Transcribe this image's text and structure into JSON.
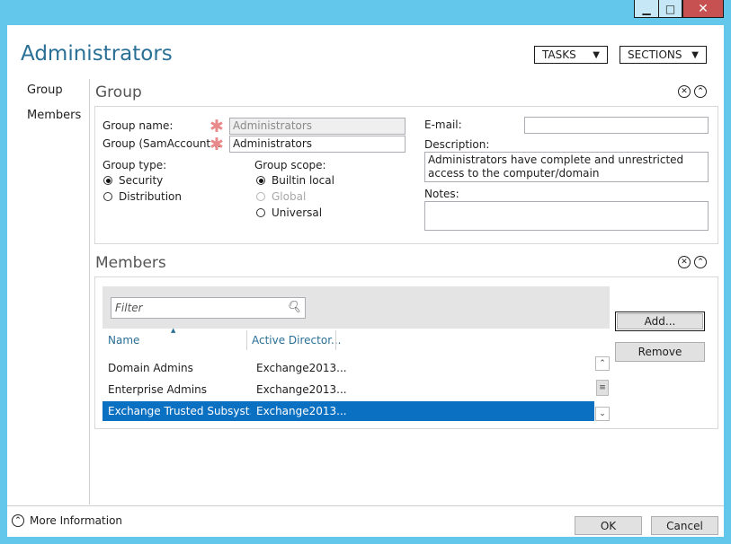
{
  "window": {
    "title": "Administrators",
    "chrome": {
      "minimize": "▁",
      "maximize": "□",
      "close": "✕"
    }
  },
  "header": {
    "tasks_label": "TASKS",
    "sections_label": "SECTIONS",
    "dropdown_arrow": "▼"
  },
  "nav": {
    "items": [
      {
        "label": "Group"
      },
      {
        "label": "Members"
      }
    ]
  },
  "group_section": {
    "title": "Group",
    "group_name_label": "Group name:",
    "group_name_value": "Administrators",
    "sam_label": "Group (SamAccount...",
    "sam_value": "Administrators",
    "required_marker": "✱",
    "group_type_label": "Group type:",
    "group_types": [
      {
        "label": "Security",
        "selected": true
      },
      {
        "label": "Distribution",
        "selected": false
      }
    ],
    "group_scope_label": "Group scope:",
    "group_scopes": [
      {
        "label": "Builtin local",
        "selected": true
      },
      {
        "label": "Global",
        "selected": false,
        "disabled": true
      },
      {
        "label": "Universal",
        "selected": false
      }
    ],
    "email_label": "E-mail:",
    "email_value": "",
    "description_label": "Description:",
    "description_value": "Administrators have complete and unrestricted access to the computer/domain",
    "notes_label": "Notes:",
    "notes_value": ""
  },
  "members_section": {
    "title": "Members",
    "filter_placeholder": "Filter",
    "columns": [
      "Name",
      "Active Director..."
    ],
    "sort_indicator": "▲",
    "rows": [
      {
        "name": "Domain Admins",
        "ad": "Exchange2013..."
      },
      {
        "name": "Enterprise Admins",
        "ad": "Exchange2013..."
      },
      {
        "name": "Exchange Trusted Subsyst...",
        "ad": "Exchange2013...",
        "selected": true
      }
    ],
    "add_label": "Add...",
    "remove_label": "Remove",
    "scroll_up": "⌃",
    "scroll_thumb": "≡",
    "scroll_down": "⌄"
  },
  "section_controls": {
    "collapse": "✕",
    "expand_up": "⌃"
  },
  "footer": {
    "more_info_label": "More Information",
    "ok_label": "OK",
    "cancel_label": "Cancel"
  },
  "colors": {
    "accent": "#2a6f96",
    "selection": "#0a70c1",
    "frame": "#62c7eb",
    "close": "#c75050"
  }
}
